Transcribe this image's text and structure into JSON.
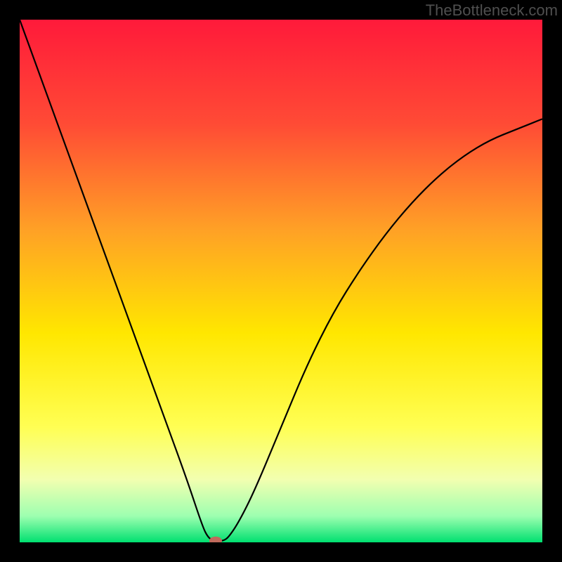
{
  "watermark": "TheBottleneck.com",
  "chart_data": {
    "type": "line",
    "title": "",
    "xlabel": "",
    "ylabel": "",
    "xlim": [
      0,
      100
    ],
    "ylim": [
      0,
      100
    ],
    "background_gradient": {
      "stops": [
        {
          "pos": 0.0,
          "color": "#ff1a3a"
        },
        {
          "pos": 0.2,
          "color": "#ff4b35"
        },
        {
          "pos": 0.4,
          "color": "#ffa026"
        },
        {
          "pos": 0.6,
          "color": "#ffe700"
        },
        {
          "pos": 0.78,
          "color": "#ffff54"
        },
        {
          "pos": 0.88,
          "color": "#f2ffb0"
        },
        {
          "pos": 0.95,
          "color": "#9dffb0"
        },
        {
          "pos": 1.0,
          "color": "#00e070"
        }
      ]
    },
    "series": [
      {
        "name": "bottleneck-curve",
        "x": [
          0,
          4,
          8,
          12,
          16,
          20,
          24,
          28,
          32,
          35,
          36,
          37,
          38,
          39,
          40,
          42,
          45,
          50,
          55,
          60,
          65,
          70,
          75,
          80,
          85,
          90,
          95,
          100
        ],
        "y": [
          100,
          89,
          78,
          67,
          56,
          45,
          34,
          23,
          12,
          3,
          1,
          0.3,
          0.3,
          0.3,
          1,
          4,
          10,
          22,
          34,
          44,
          52,
          59,
          65,
          70,
          74,
          77,
          79,
          81
        ]
      }
    ],
    "marker": {
      "name": "optimal-point",
      "x": 37.5,
      "y": 0.3,
      "color": "#c06a5c",
      "rx": 9,
      "ry": 6
    }
  }
}
